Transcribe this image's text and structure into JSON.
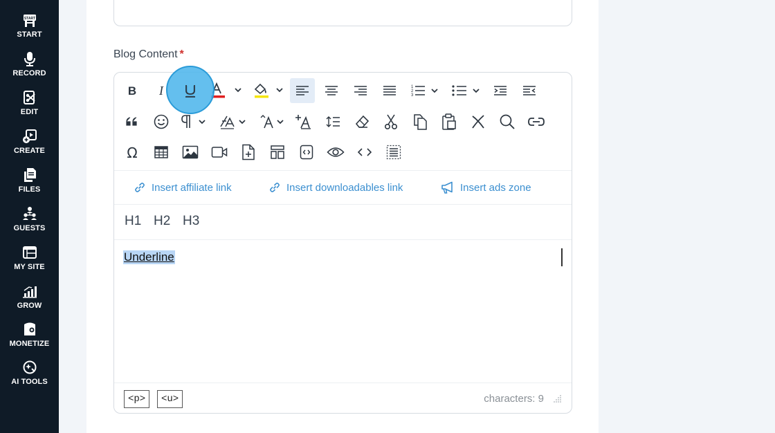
{
  "sidebar": {
    "items": [
      {
        "label": "START",
        "icon": "start-icon"
      },
      {
        "label": "RECORD",
        "icon": "microphone-icon"
      },
      {
        "label": "EDIT",
        "icon": "edit-icon"
      },
      {
        "label": "CREATE",
        "icon": "create-icon"
      },
      {
        "label": "FILES",
        "icon": "files-icon"
      },
      {
        "label": "GUESTS",
        "icon": "guests-icon"
      },
      {
        "label": "MY SITE",
        "icon": "my-site-icon"
      },
      {
        "label": "GROW",
        "icon": "grow-icon"
      },
      {
        "label": "MONETIZE",
        "icon": "monetize-icon"
      },
      {
        "label": "AI TOOLS",
        "icon": "ai-tools-icon"
      }
    ],
    "start_badge": "START"
  },
  "form": {
    "blog_content_label": "Blog Content",
    "required_marker": "*"
  },
  "editor": {
    "toolbar_row1": [
      "bold",
      "italic",
      "underline",
      "font-color",
      "highlight-color",
      "align-left",
      "align-center",
      "align-right",
      "justify",
      "numbered-list",
      "bullet-list",
      "indent",
      "outdent"
    ],
    "toolbar_row2": [
      "blockquote",
      "emoticons",
      "paragraph",
      "line-height",
      "font-size",
      "clear-formatting-style",
      "line-spacing",
      "eraser",
      "cut",
      "copy",
      "paste",
      "remove-format",
      "search",
      "link"
    ],
    "toolbar_row3": [
      "special-character",
      "table",
      "image",
      "video",
      "insert-file",
      "template",
      "code-sample",
      "preview",
      "source-code",
      "select-all"
    ],
    "insert_affiliate_link": "Insert affiliate link",
    "insert_downloadables_link": "Insert downloadables link",
    "insert_ads_zone": "Insert ads zone",
    "headings": [
      "H1",
      "H2",
      "H3"
    ],
    "body_text": "Underline",
    "path_tags": [
      "<p>",
      "<u>"
    ],
    "character_count": "characters: 9",
    "active_button": "underline"
  },
  "colors": {
    "sidebar_bg": "#0f1b27",
    "link_blue": "#3b8fd0",
    "required_red": "#d0312d",
    "font_color_bar": "#e02020",
    "highlight_bar": "#f5e50a",
    "click_indicator": "#4fb6ec"
  }
}
